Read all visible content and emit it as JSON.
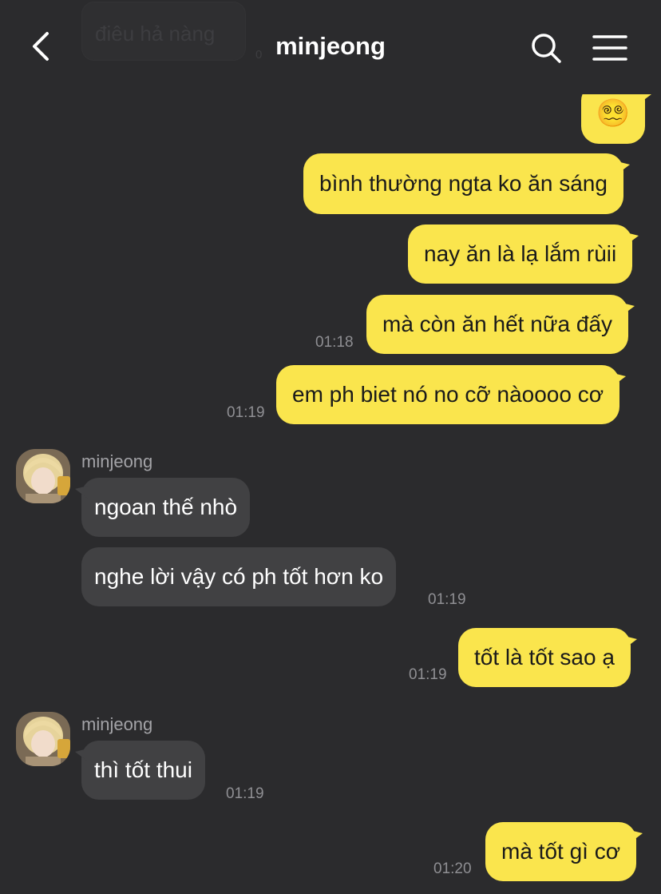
{
  "header": {
    "title": "minjeong",
    "back_icon": "chevron-left-icon",
    "search_icon": "search-icon",
    "menu_icon": "hamburger-menu-icon"
  },
  "ghost_message": {
    "text": "điêu hả nàng",
    "time": "0"
  },
  "messages": [
    {
      "direction": "out",
      "text": "😵‍💫"
    },
    {
      "direction": "out",
      "text": "bình thường ngta ko ăn sáng"
    },
    {
      "direction": "out",
      "text": "nay ăn là lạ lắm rùii"
    },
    {
      "direction": "out",
      "text": "mà còn ăn hết nữa đấy",
      "time": "01:18"
    },
    {
      "direction": "out",
      "text": "em ph biet nó no cỡ nàoooo cơ",
      "time": "01:19"
    },
    {
      "direction": "in",
      "sender": "minjeong",
      "text": "ngoan thế nhò"
    },
    {
      "direction": "in",
      "text": "nghe lời vậy có ph tốt hơn ko",
      "time": "01:19"
    },
    {
      "direction": "out",
      "text": "tốt là tốt sao ạ",
      "time": "01:19"
    },
    {
      "direction": "in",
      "sender": "minjeong",
      "text": "thì tốt thui",
      "time": "01:19"
    },
    {
      "direction": "out",
      "text": "mà tốt gì cơ",
      "time": "01:20"
    }
  ],
  "colors": {
    "background": "#2b2b2d",
    "outgoing_bubble": "#fae54d",
    "incoming_bubble": "#414143",
    "timestamp": "#8f8f93"
  }
}
